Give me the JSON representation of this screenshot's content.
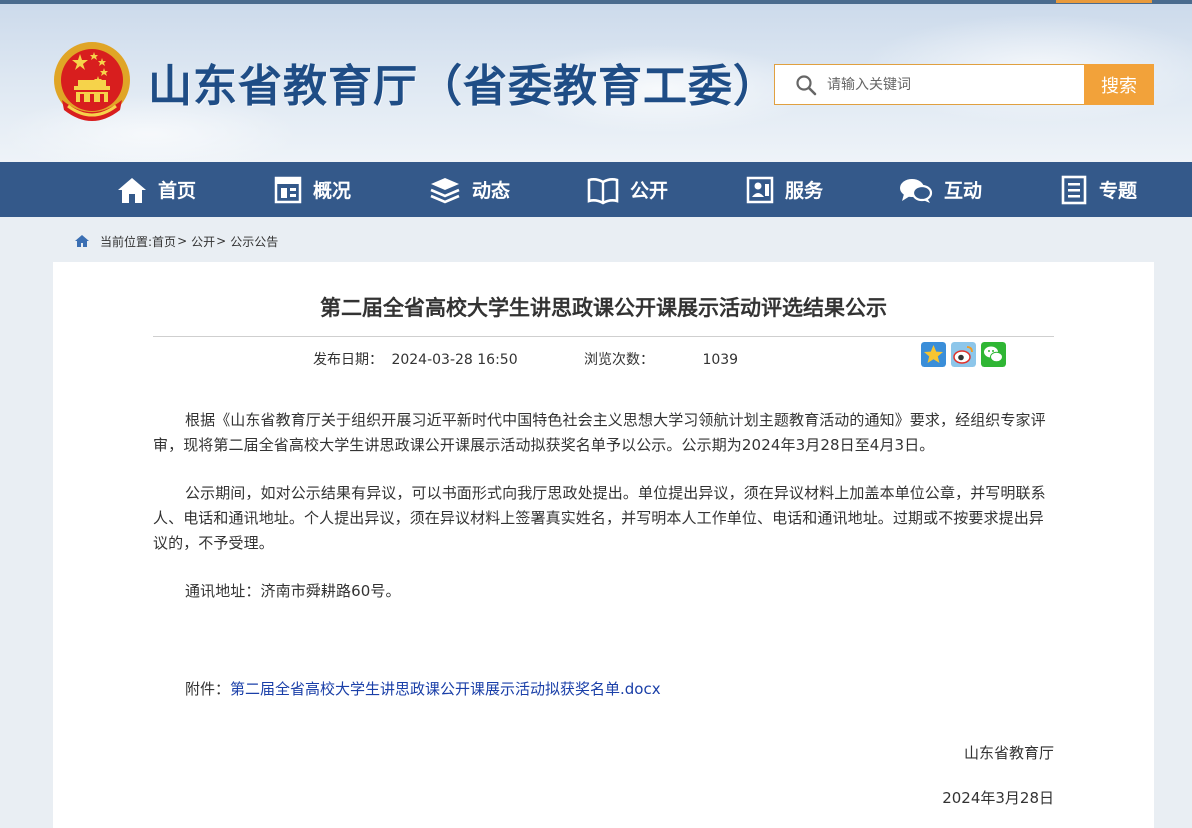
{
  "header": {
    "site_title": "山东省教育厅（省委教育工委）",
    "search": {
      "placeholder": "请输入关键词",
      "button_label": "搜索"
    }
  },
  "nav": {
    "items": [
      {
        "label": "首页",
        "icon": "home-icon"
      },
      {
        "label": "概况",
        "icon": "overview-icon"
      },
      {
        "label": "动态",
        "icon": "news-icon"
      },
      {
        "label": "公开",
        "icon": "book-icon"
      },
      {
        "label": "服务",
        "icon": "service-icon"
      },
      {
        "label": "互动",
        "icon": "chat-icon"
      },
      {
        "label": "专题",
        "icon": "document-icon"
      }
    ]
  },
  "breadcrumb": {
    "prefix": "当前位置:",
    "items": [
      "首页",
      "公开",
      "公示公告"
    ],
    "separator": ">"
  },
  "article": {
    "title": "第二届全省高校大学生讲思政课公开课展示活动评选结果公示",
    "publish_label": "发布日期：",
    "publish_date": "2024-03-28 16:50",
    "views_label": "浏览次数：",
    "views": "1039",
    "share_icons": [
      "qzone-icon",
      "weibo-icon",
      "wechat-icon"
    ],
    "paragraphs": [
      "根据《山东省教育厅关于组织开展习近平新时代中国特色社会主义思想大学习领航计划主题教育活动的通知》要求，经组织专家评审，现将第二届全省高校大学生讲思政课公开课展示活动拟获奖名单予以公示。公示期为2024年3月28日至4月3日。",
      "公示期间，如对公示结果有异议，可以书面形式向我厅思政处提出。单位提出异议，须在异议材料上加盖本单位公章，并写明联系人、电话和通讯地址。个人提出异议，须在异议材料上签署真实姓名，并写明本人工作单位、电话和通讯地址。过期或不按要求提出异议的，不予受理。",
      "通讯地址：济南市舜耕路60号。"
    ],
    "attachment_label": "附件：",
    "attachment_link": "第二届全省高校大学生讲思政课公开课展示活动拟获奖名单.docx",
    "signature": "山东省教育厅",
    "sign_date": "2024年3月28日"
  }
}
